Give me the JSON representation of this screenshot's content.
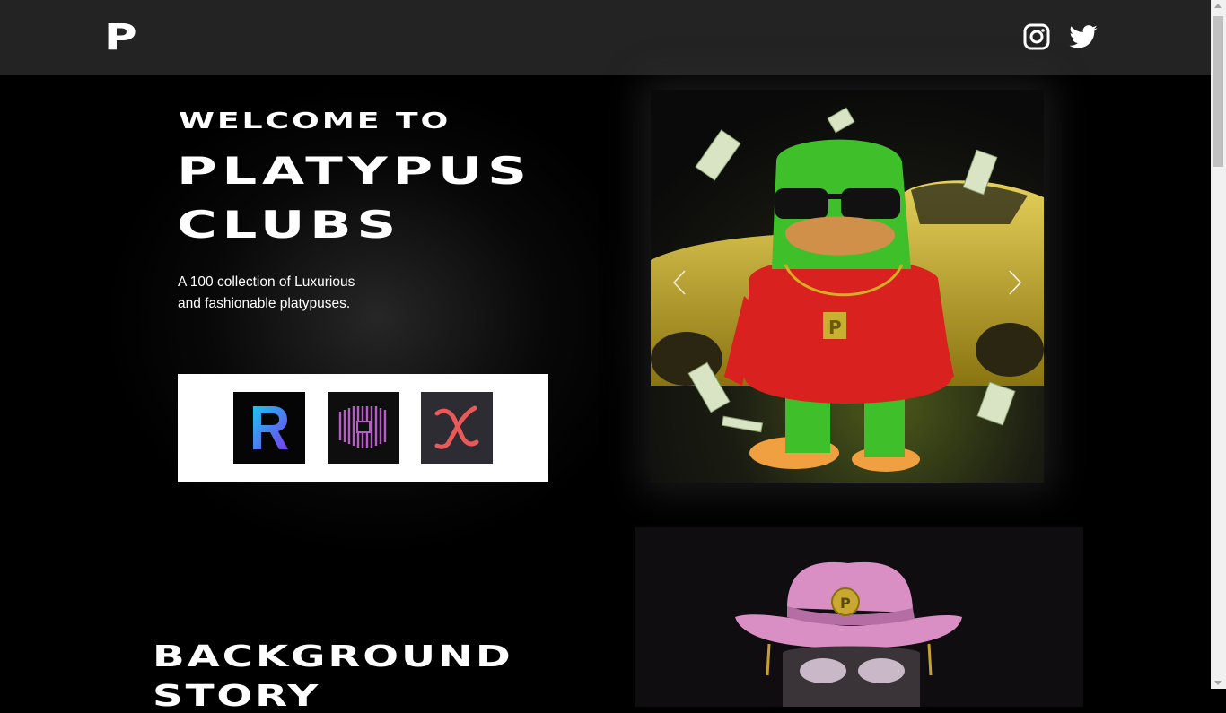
{
  "header": {
    "logo_letter": "P",
    "social": [
      {
        "name": "instagram",
        "icon": "instagram-icon"
      },
      {
        "name": "twitter",
        "icon": "twitter-icon"
      }
    ]
  },
  "hero": {
    "welcome": "WELCOME TO",
    "title_line1": "PLATYPUS",
    "title_line2": "CLUBS",
    "tagline_line1": "A 100 collection of Luxurious",
    "tagline_line2": "and fashionable platypuses."
  },
  "partners": [
    {
      "icon": "rarible-logo-icon",
      "letter": "R"
    },
    {
      "icon": "striped-cube-logo-icon"
    },
    {
      "icon": "x-script-logo-icon",
      "letter": "x"
    }
  ],
  "carousel": {
    "prev_icon": "chevron-left-icon",
    "next_icon": "chevron-right-icon"
  },
  "background_story": {
    "heading_line1": "BACKGROUND",
    "heading_line2": "STORY"
  },
  "colors": {
    "topbar": "#232323",
    "page_bg": "#000000",
    "platypus_green": "#3fbf2a",
    "sweater_red": "#d9221f",
    "car_gold": "#c2a92a",
    "hat_pink": "#d98fc4"
  }
}
